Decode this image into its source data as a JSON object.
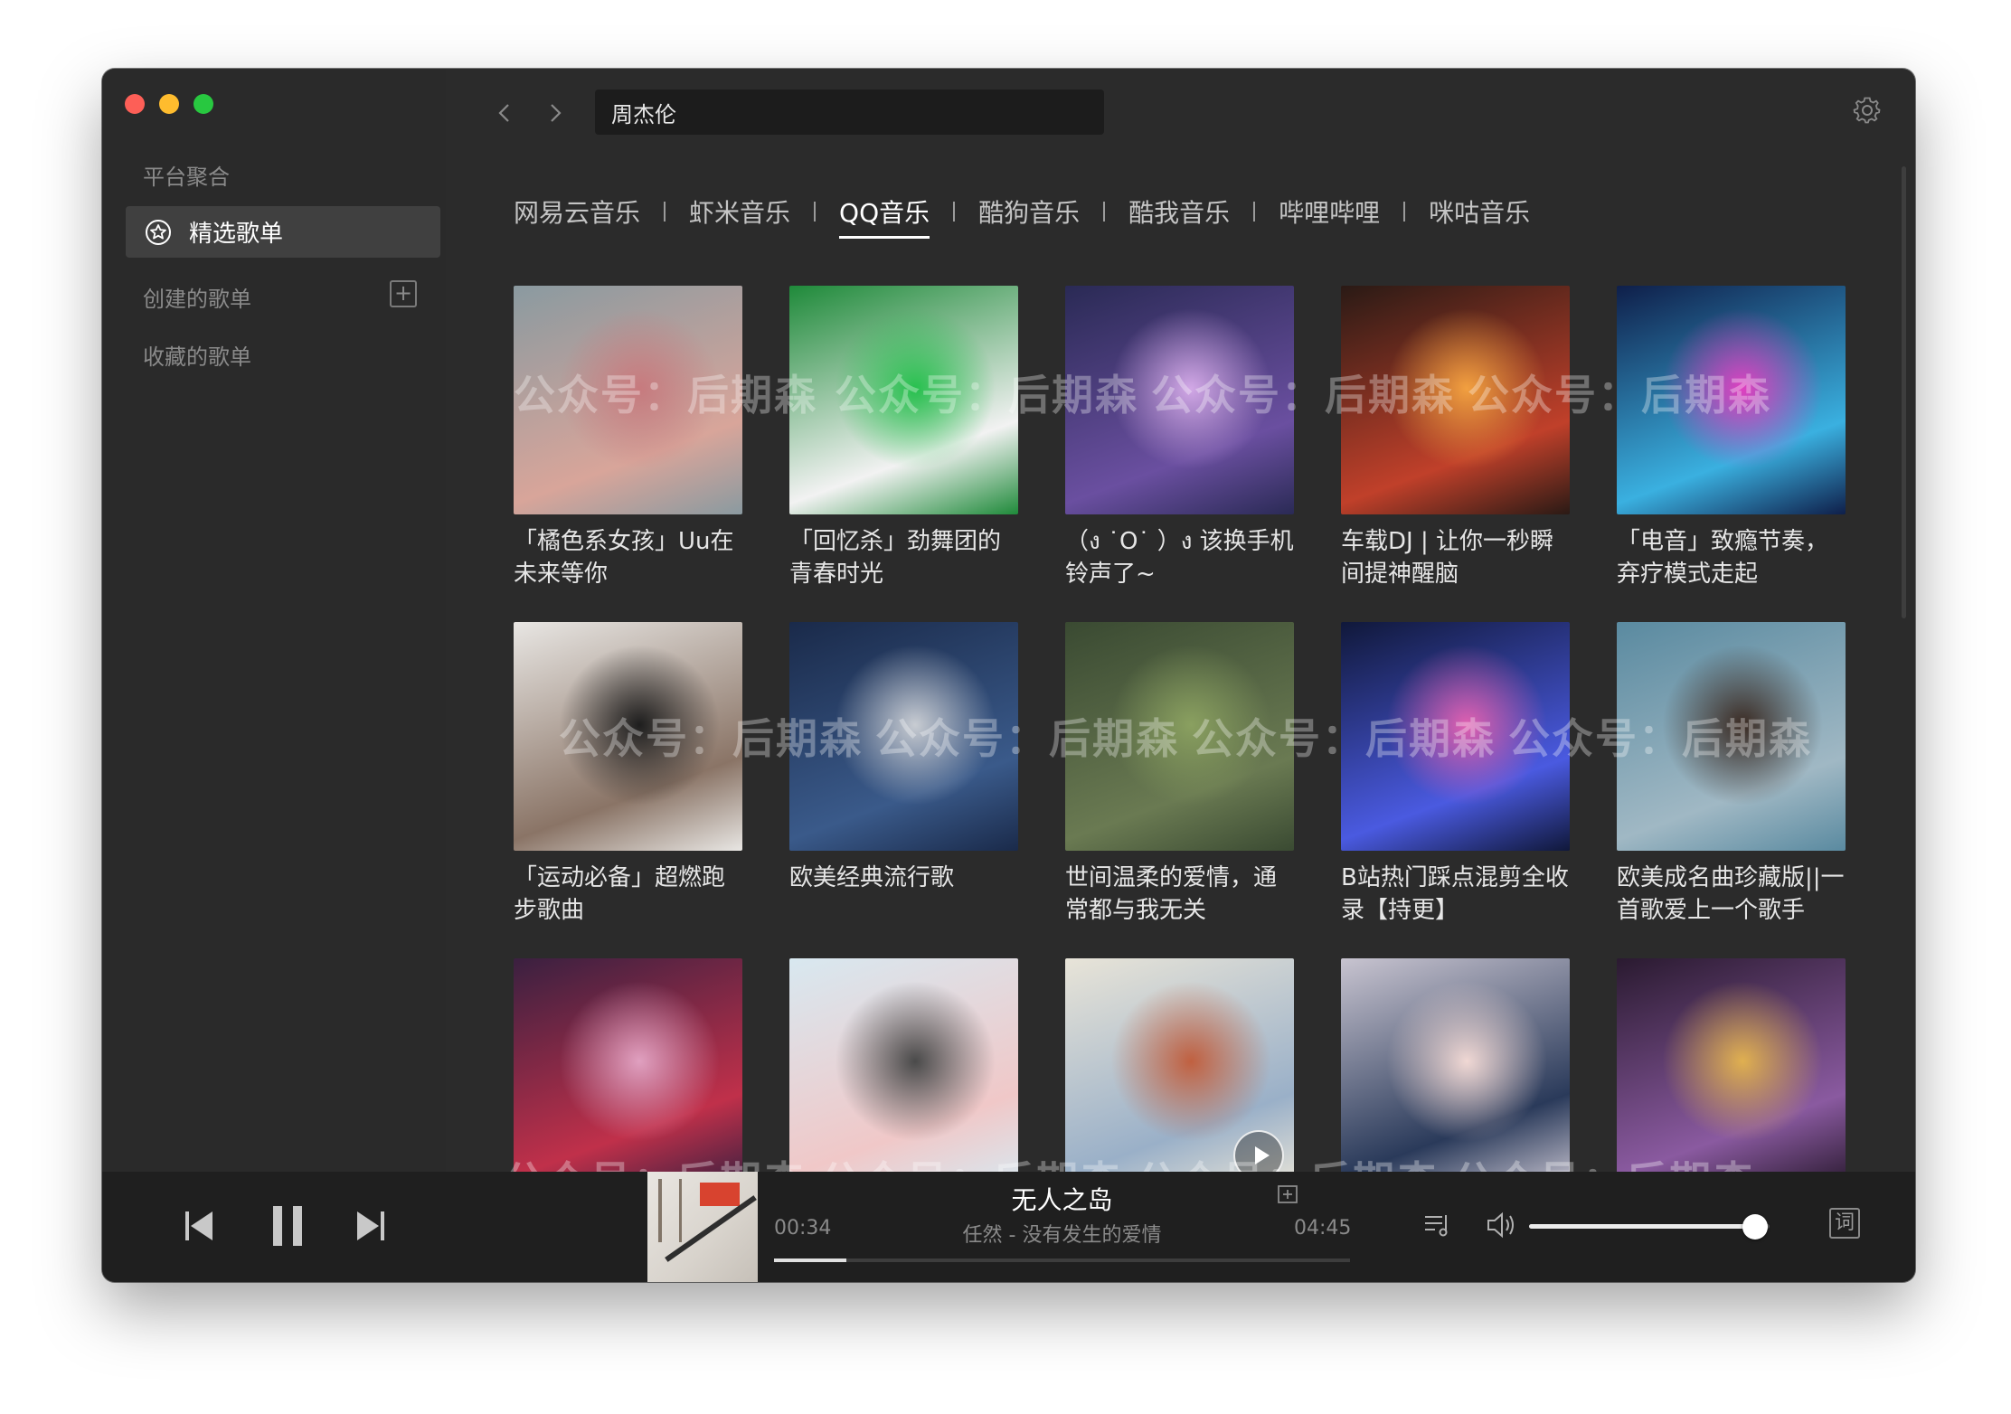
{
  "window": {
    "traffic_lights": [
      "close",
      "minimize",
      "zoom"
    ]
  },
  "sidebar": {
    "heading": "平台聚合",
    "active_item": {
      "label": "精选歌单",
      "icon": "star-circle-icon"
    },
    "created_label": "创建的歌单",
    "add_icon": "+",
    "favorites_label": "收藏的歌单"
  },
  "search": {
    "value": "周杰伦"
  },
  "tabs": [
    {
      "label": "网易云音乐",
      "active": false
    },
    {
      "label": "虾米音乐",
      "active": false
    },
    {
      "label": "QQ音乐",
      "active": true
    },
    {
      "label": "酷狗音乐",
      "active": false
    },
    {
      "label": "酷我音乐",
      "active": false
    },
    {
      "label": "哔哩哔哩",
      "active": false
    },
    {
      "label": "咪咕音乐",
      "active": false
    }
  ],
  "playlists": [
    {
      "title": "「橘色系女孩」Uu在未来等你",
      "colors": [
        "#8a9aa0",
        "#d8a59a",
        "#c77a7e"
      ]
    },
    {
      "title": "「回忆杀」劲舞团的青春时光",
      "colors": [
        "#1f8a3a",
        "#f2f2f2",
        "#27c04e"
      ]
    },
    {
      "title": "（ง ˙O˙ ）ง 该换手机铃声了~",
      "colors": [
        "#2a2a55",
        "#6a4fa0",
        "#d2a8e6"
      ]
    },
    {
      "title": "车载DJ | 让你一秒瞬间提神醒脑",
      "colors": [
        "#2a1a15",
        "#c0402a",
        "#f2a040"
      ]
    },
    {
      "title": "「电音」致瘾节奏，弃疗模式走起",
      "colors": [
        "#0f1f4a",
        "#3ab0e0",
        "#e040c0"
      ]
    },
    {
      "title": "「运动必备」超燃跑步歌曲",
      "colors": [
        "#e8e6e3",
        "#8a7466",
        "#1e1e1e"
      ]
    },
    {
      "title": "欧美经典流行歌",
      "colors": [
        "#1a2a4a",
        "#3a5a8a",
        "#c8ccd2"
      ]
    },
    {
      "title": "世间温柔的爱情，通常都与我无关",
      "colors": [
        "#3a4a32",
        "#6a7a52",
        "#8aa060"
      ]
    },
    {
      "title": "B站热门踩点混剪全收录【持更】",
      "colors": [
        "#10183a",
        "#4a5ae0",
        "#e060b0"
      ]
    },
    {
      "title": "欧美成名曲珍藏版||一首歌爱上一个歌手",
      "colors": [
        "#5a8aa0",
        "#a0b8c4",
        "#3a2a22"
      ]
    },
    {
      "title": "",
      "colors": [
        "#3a2040",
        "#c0304a",
        "#e0a0c0"
      ]
    },
    {
      "title": "",
      "colors": [
        "#d8e8f0",
        "#f0c8c8",
        "#4a4a4a"
      ]
    },
    {
      "title": "",
      "colors": [
        "#e8e4d8",
        "#9ab0c8",
        "#c06040"
      ]
    },
    {
      "title": "",
      "colors": [
        "#c8c4d0",
        "#2a3a5a",
        "#f0d8d4"
      ]
    },
    {
      "title": "",
      "colors": [
        "#2a1a30",
        "#8a5aa0",
        "#e0b050"
      ]
    }
  ],
  "player": {
    "song_title": "无人之岛",
    "artist_line": "任然 - 没有发生的爱情",
    "current_time": "00:34",
    "total_time": "04:45",
    "progress": 0.125,
    "volume": 0.94,
    "lyric_label": "词",
    "icons": [
      "previous-icon",
      "pause-icon",
      "next-icon",
      "add-to-playlist-icon",
      "queue-icon",
      "volume-icon",
      "lyric-icon"
    ]
  },
  "watermark": {
    "text": "公众号：后期森"
  }
}
